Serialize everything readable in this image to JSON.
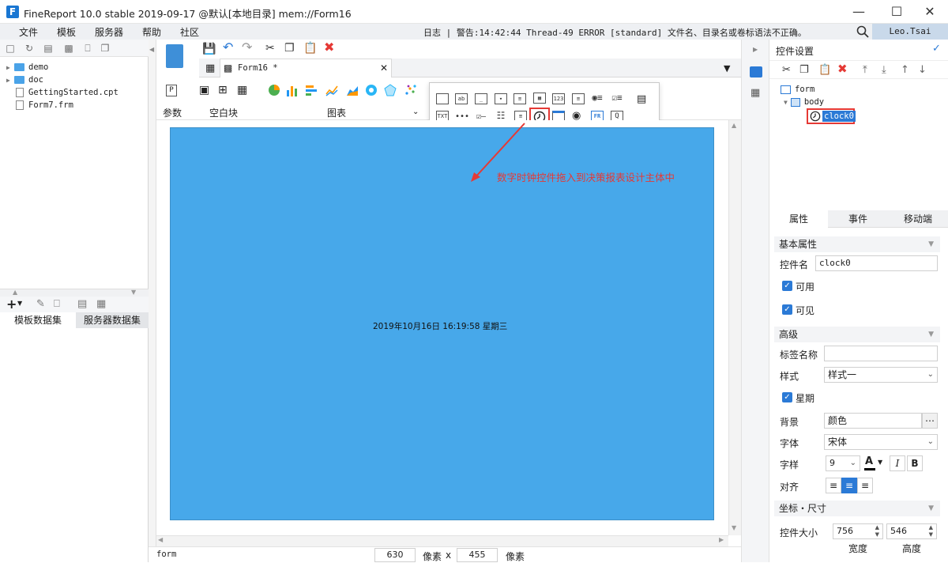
{
  "window": {
    "title": "FineReport 10.0 stable 2019-09-17 @默认[本地目录]    mem://Form16",
    "logo_letter": "F"
  },
  "menu": {
    "items": [
      "文件",
      "模板",
      "服务器",
      "帮助",
      "社区"
    ],
    "log": "日志 | 警告:14:42:44 Thread-49 ERROR [standard] 文件名、目录名或卷标语法不正确。",
    "user": "Leo.Tsai"
  },
  "left": {
    "tree": [
      {
        "name": "demo",
        "type": "folder"
      },
      {
        "name": "doc",
        "type": "folder"
      },
      {
        "name": "GettingStarted.cpt",
        "type": "file"
      },
      {
        "name": "Form7.frm",
        "type": "file"
      }
    ],
    "ds_tabs": [
      "模板数据集",
      "服务器数据集"
    ]
  },
  "tab": {
    "label": "Form16 *"
  },
  "component_toolbar": {
    "param_label": "参数",
    "blank_label": "空白块",
    "chart_label": "图表"
  },
  "canvas": {
    "clock_text": "2019年10月16日   16:19:58   星期三",
    "annotation": "数字时钟控件拖入到决策报表设计主体中",
    "body_color": "#47a8ea",
    "annotation_color": "#e53935"
  },
  "statusbar": {
    "component": "form",
    "width": "630",
    "unit": "像素",
    "times": "x",
    "height": "455",
    "unit2": "像素"
  },
  "right": {
    "title": "控件设置",
    "tree": {
      "root": "form",
      "body": "body",
      "widget": "clock0"
    },
    "tabs": [
      "属性",
      "事件",
      "移动端"
    ],
    "basic_section": "基本属性",
    "name_label": "控件名",
    "name_value": "clock0",
    "enabled_label": "可用",
    "visible_label": "可见",
    "advanced_section": "高级",
    "tag_label": "标签名称",
    "tag_value": "",
    "style_label": "样式",
    "style_value": "样式一",
    "week_label": "星期",
    "bg_label": "背景",
    "bg_value": "颜色",
    "font_label": "字体",
    "font_value": "宋体",
    "size_label": "字样",
    "size_value": "9",
    "italic": "I",
    "bold": "B",
    "align_label": "对齐",
    "coord_section": "坐标・尺寸",
    "widget_size_label": "控件大小",
    "w_value": "756",
    "h_value": "546",
    "w_caption": "宽度",
    "h_caption": "高度"
  }
}
